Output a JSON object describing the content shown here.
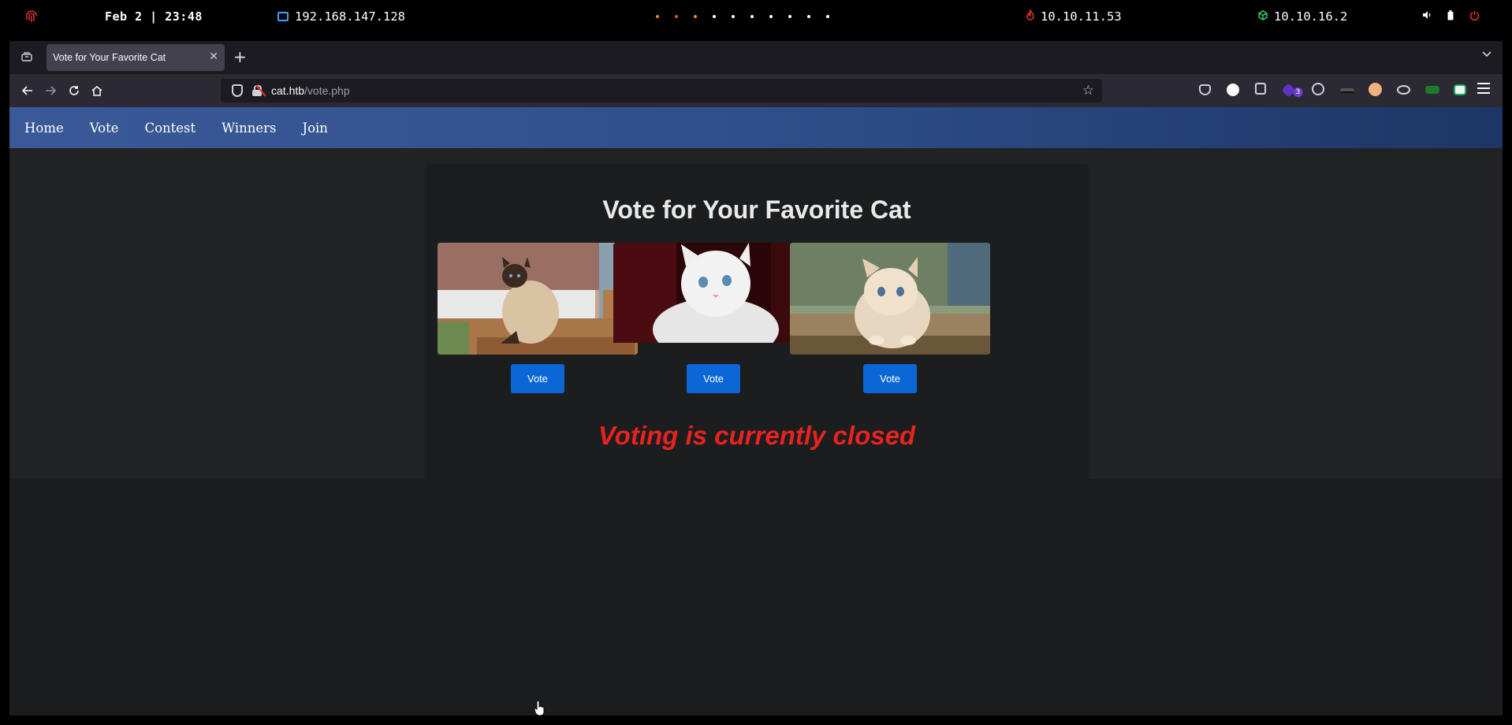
{
  "system_bar": {
    "datetime": "Feb 2 | 23:48",
    "ip_local": "192.168.147.128",
    "ip_target": "10.10.11.53",
    "ip_vpn": "10.10.16.2",
    "workspaces": 10,
    "icons": [
      "fingerprint-icon",
      "monitor-icon",
      "flame-icon",
      "cube-icon",
      "volume-icon",
      "battery-icon",
      "power-icon"
    ]
  },
  "browser": {
    "tab_title": "Vote for Your Favorite Cat",
    "url_host": "cat.htb",
    "url_path": "/vote.php",
    "extension_badge": "3"
  },
  "site": {
    "nav": [
      "Home",
      "Vote",
      "Contest",
      "Winners",
      "Join"
    ],
    "title": "Vote for Your Favorite Cat",
    "vote_label": "Vote",
    "status": "Voting is currently closed"
  },
  "colors": {
    "nav_gradient_start": "#3b5998",
    "vote_button": "#0b67d6",
    "status_text": "#e8231e",
    "page_bg": "#1a1c1e"
  }
}
